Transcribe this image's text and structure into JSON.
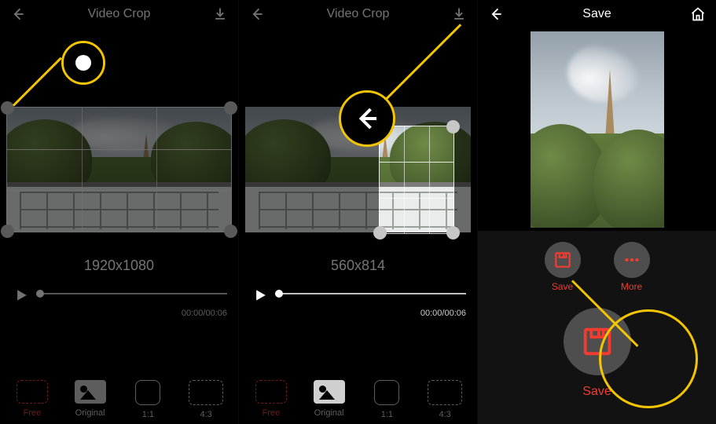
{
  "accent_color": "#f33b2f",
  "callout_color": "#f3c400",
  "screen1": {
    "title": "Video Crop",
    "dimensions": "1920x1080",
    "timecode": "00:00/00:06",
    "aspects": {
      "free": "Free",
      "original": "Original",
      "one_one": "1:1",
      "four_three": "4:3"
    }
  },
  "screen2": {
    "title": "Video Crop",
    "dimensions": "560x814",
    "timecode": "00:00/00:06",
    "aspects": {
      "free": "Free",
      "original": "Original",
      "one_one": "1:1",
      "four_three": "4:3"
    }
  },
  "screen3": {
    "title": "Save",
    "save_label": "Save",
    "more_label": "More",
    "big_save_label": "Save"
  }
}
